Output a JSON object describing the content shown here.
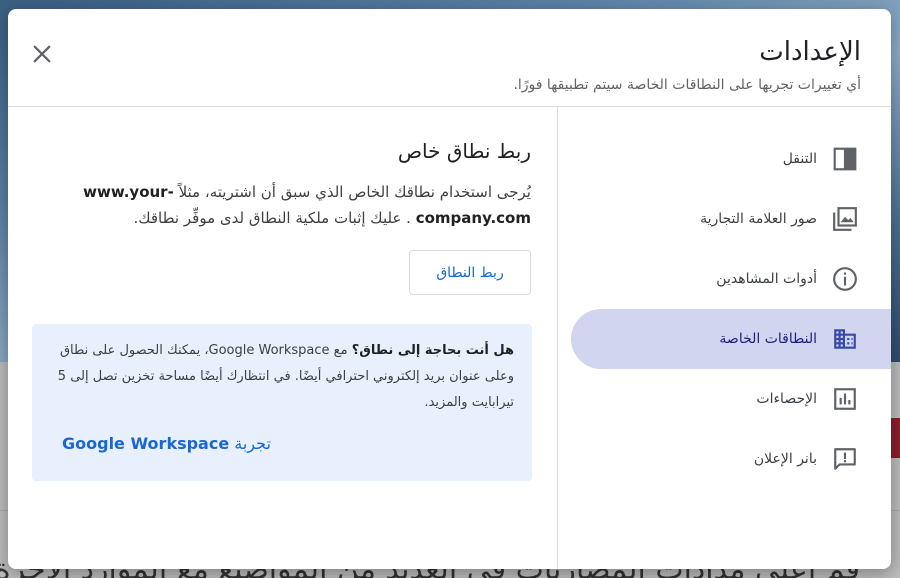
{
  "background": {
    "text": "قم اعلى مدادات المصاربات في العديد من المواضيع مع الموارد الاخرة"
  },
  "dialog": {
    "title": "الإعدادات",
    "subtitle": "أي تغييرات تجريها على النطاقات الخاصة سيتم تطبيقها فورًا.",
    "close_icon": "close-icon"
  },
  "sidebar": {
    "items": [
      {
        "label": "التنقل",
        "icon": "navigation-panel-icon",
        "active": false
      },
      {
        "label": "صور العلامة التجارية",
        "icon": "image-icon",
        "active": false
      },
      {
        "label": "أدوات المشاهدين",
        "icon": "info-icon",
        "active": false
      },
      {
        "label": "النطاقات الخاصة",
        "icon": "domain-icon",
        "active": true
      },
      {
        "label": "الإحصاءات",
        "icon": "analytics-icon",
        "active": false
      },
      {
        "label": "بانر الإعلان",
        "icon": "announcement-icon",
        "active": false
      }
    ],
    "accent_color": "#d2d5ef"
  },
  "main": {
    "title": "ربط نطاق خاص",
    "desc_part1": "يُرجى استخدام نطاقك الخاص الذي سبق أن اشتريته، مثلاً ",
    "desc_domain": "www.your-company.com",
    "desc_part2": " . عليك إثبات ملكية النطاق لدى موفِّر نطاقك.",
    "connect_button": "ربط النطاق",
    "promo": {
      "bold": "هل أنت بحاجة إلى نطاق؟",
      "text": " مع Google Workspace، يمكنك الحصول على نطاق وعلى عنوان بريد إلكتروني احترافي أيضًا. في انتظارك أيضًا مساحة تخزين تصل إلى 5 تيرابايت والمزيد.",
      "link_prefix": "تجربة ",
      "link_product": "Google Workspace"
    },
    "link_color": "#1967d2",
    "promo_bg": "#e8f0fe"
  }
}
